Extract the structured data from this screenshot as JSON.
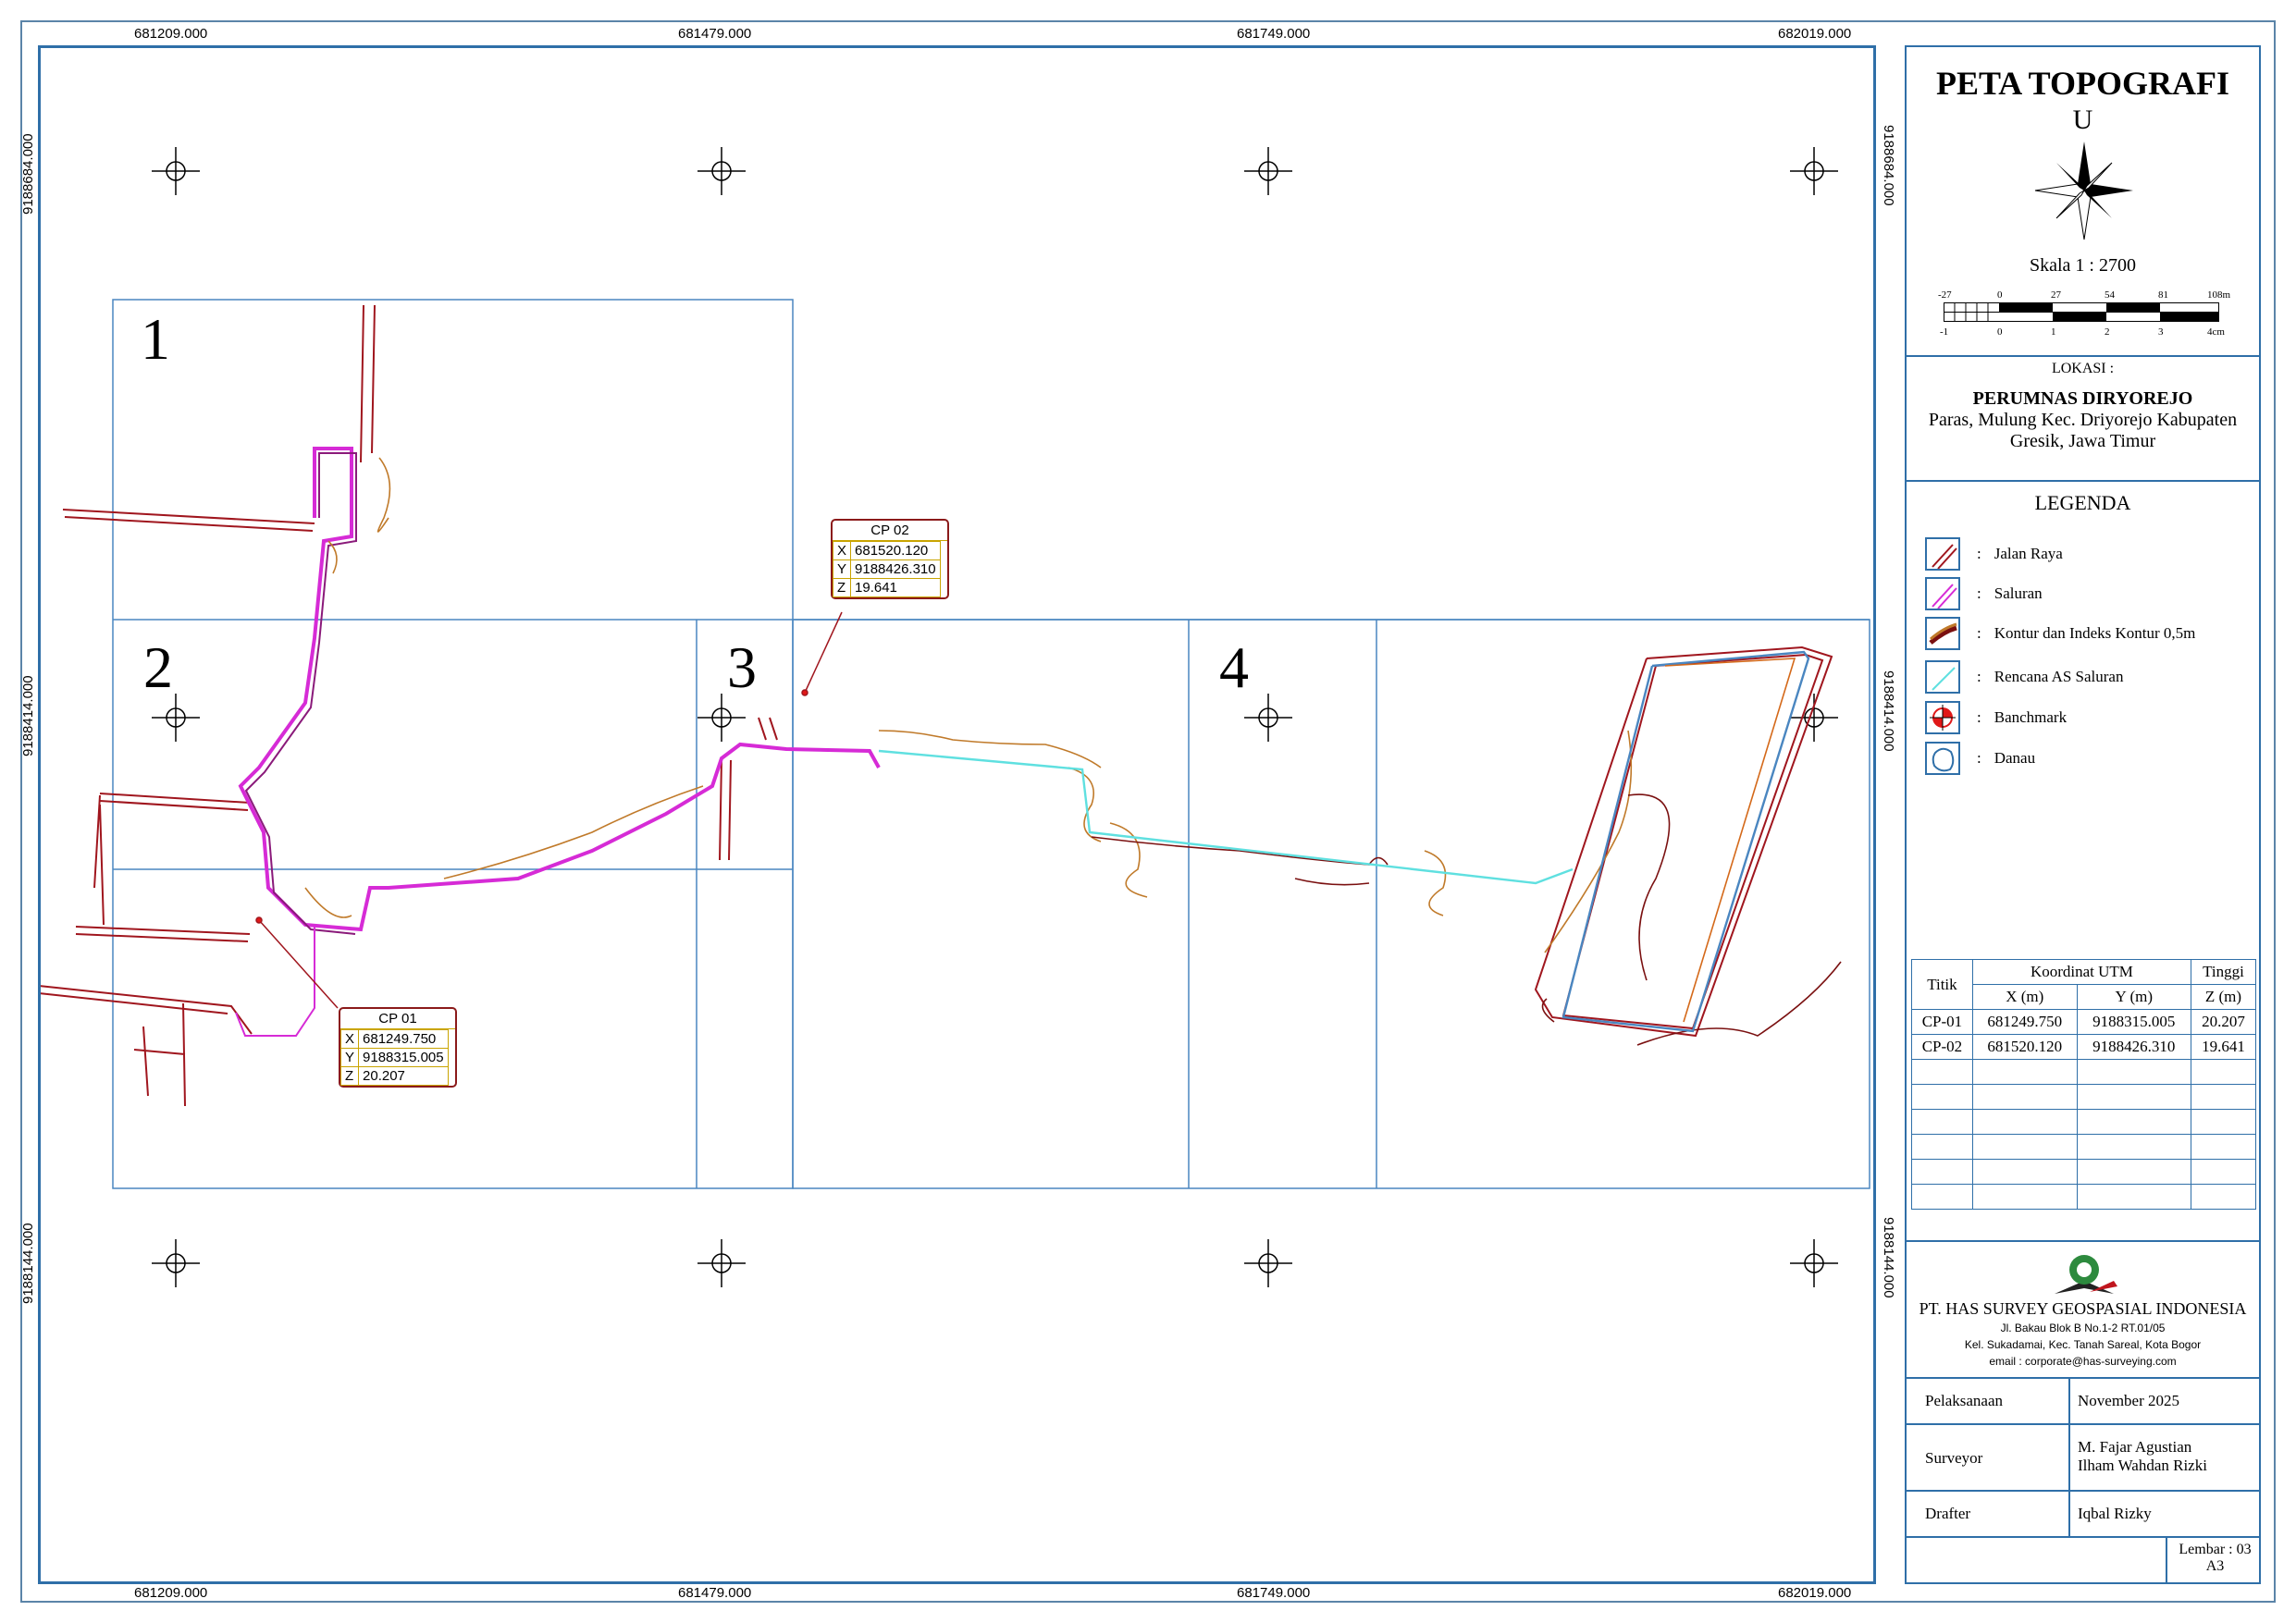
{
  "grid": {
    "x_labels": [
      "681209.000",
      "681479.000",
      "681749.000",
      "682019.000"
    ],
    "y_labels": [
      "9188684.000",
      "9188414.000",
      "9188144.000"
    ]
  },
  "sheets": [
    "1",
    "2",
    "3",
    "4"
  ],
  "control_points": [
    {
      "name": "CP 01",
      "x_label": "X",
      "x": "681249.750",
      "y_label": "Y",
      "y": "9188315.005",
      "z_label": "Z",
      "z": "20.207"
    },
    {
      "name": "CP 02",
      "x_label": "X",
      "x": "681520.120",
      "y_label": "Y",
      "y": "9188426.310",
      "z_label": "Z",
      "z": "19.641"
    }
  ],
  "panel": {
    "title": "PETA TOPOGRAFI",
    "north": "U",
    "scale": "Skala 1 : 2700",
    "scalebar_top": [
      "-27",
      "0",
      "27",
      "54",
      "81",
      "108m"
    ],
    "scalebar_bottom": [
      "-1",
      "0",
      "1",
      "2",
      "3",
      "4cm"
    ],
    "location_label": "LOKASI :",
    "location_name": "PERUMNAS DIRYOREJO",
    "location_addr1": "Paras, Mulung Kec. Driyorejo Kabupaten",
    "location_addr2": "Gresik, Jawa Timur",
    "legend_title": "LEGENDA",
    "legend": [
      {
        "label": "Jalan Raya",
        "icon": "road-icon",
        "color": "#a0161e"
      },
      {
        "label": "Saluran",
        "icon": "channel-icon",
        "color": "#d62bd6"
      },
      {
        "label": "Kontur dan Indeks Kontur 0,5m",
        "icon": "contour-icon",
        "color": "#c07a2a"
      },
      {
        "label": "Rencana AS Saluran",
        "icon": "plan-channel-icon",
        "color": "#5fe0e0"
      },
      {
        "label": "Banchmark",
        "icon": "benchmark-icon",
        "color": "#e01818"
      },
      {
        "label": "Danau",
        "icon": "lake-icon",
        "color": "#2f6fa8"
      }
    ],
    "table": {
      "h_titik": "Titik",
      "h_koordinat": "Koordinat UTM",
      "h_tinggi": "Tinggi",
      "h_x": "X (m)",
      "h_y": "Y (m)",
      "h_z": "Z (m)",
      "rows": [
        [
          "CP-01",
          "681249.750",
          "9188315.005",
          "20.207"
        ],
        [
          "CP-02",
          "681520.120",
          "9188426.310",
          "19.641"
        ]
      ]
    },
    "company": "PT. HAS SURVEY GEOSPASIAL INDONESIA",
    "company_addr1": "Jl. Bakau Blok B No.1-2 RT.01/05",
    "company_addr2": "Kel. Sukadamai, Kec. Tanah Sareal, Kota Bogor",
    "company_email": "email : corporate@has-surveying.com",
    "pelaksanaan_label": "Pelaksanaan",
    "pelaksanaan": "November 2025",
    "surveyor_label": "Surveyor",
    "surveyor1": "M. Fajar Agustian",
    "surveyor2": "Ilham Wahdan Rizki",
    "drafter_label": "Drafter",
    "drafter": "Iqbal Rizky",
    "lembar": "Lembar : 03",
    "paper": "A3"
  }
}
